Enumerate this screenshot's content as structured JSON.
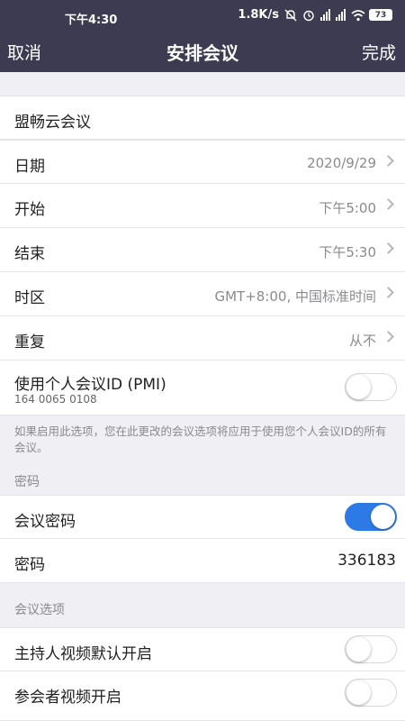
{
  "status": {
    "time": "下午4:30",
    "speed": "1.8K/s",
    "net1": "HD",
    "net2": "HD",
    "battery": "73"
  },
  "nav": {
    "cancel": "取消",
    "title": "安排会议",
    "done": "完成"
  },
  "topic": "盟畅云会议",
  "rows": {
    "date": {
      "label": "日期",
      "value": "2020/9/29"
    },
    "start": {
      "label": "开始",
      "value": "下午5:00"
    },
    "end": {
      "label": "结束",
      "value": "下午5:30"
    },
    "timezone": {
      "label": "时区",
      "value": "GMT+8:00, 中国标准时间"
    },
    "repeat": {
      "label": "重复",
      "value": "从不"
    },
    "pmi": {
      "label": "使用个人会议ID (PMI)",
      "sub": "164 0065 0108"
    }
  },
  "pmi_note": "如果启用此选项，您在此更改的会议选项将应用于使用您个人会议ID的所有会议。",
  "password_section": {
    "header": "密码",
    "toggle_label": "会议密码",
    "password_label": "密码",
    "password_value": "336183"
  },
  "options_section": {
    "header": "会议选项",
    "host_video": "主持人视频默认开启",
    "participant_video": "参会者视频开启"
  },
  "colors": {
    "header_bg": "#3c3b52",
    "toggle_on": "#2d7ae6"
  }
}
